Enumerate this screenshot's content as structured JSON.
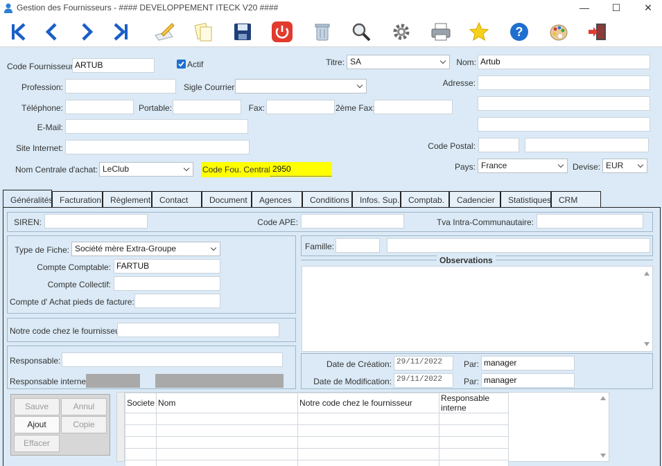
{
  "window": {
    "title": "Gestion des Fournisseurs - #### DEVELOPPEMENT ITECK V20 ####",
    "minimize": "—",
    "maximize": "☐",
    "close": "✕"
  },
  "toolbar": [
    "first-icon",
    "prev-icon",
    "next-icon",
    "last-icon",
    "edit-icon",
    "copy-icon",
    "save-icon",
    "power-icon",
    "trash-icon",
    "search-icon",
    "settings-icon",
    "print-icon",
    "star-icon",
    "help-icon",
    "palette-icon",
    "exit-icon"
  ],
  "header": {
    "code_label": "Code Fournisseur:",
    "code_value": "ARTUB",
    "actif_label": "Actif",
    "titre_label": "Titre:",
    "titre_value": "SA",
    "nom_label": "Nom:",
    "nom_value": "Artub",
    "profession_label": "Profession:",
    "sigle_label": "Sigle Courrier:",
    "adresse_label": "Adresse:",
    "telephone_label": "Téléphone:",
    "portable_label": "Portable:",
    "fax_label": "Fax:",
    "fax2_label": "2ème Fax:",
    "email_label": "E-Mail:",
    "site_label": "Site Internet:",
    "code_postal_label": "Code Postal:",
    "centrale_label": "Nom Centrale d'achat:",
    "centrale_value": "LeClub",
    "code_centrale_label": "Code Fou. Centrale:",
    "code_centrale_value": "2950",
    "pays_label": "Pays:",
    "pays_value": "France",
    "devise_label": "Devise:",
    "devise_value": "EUR"
  },
  "tabs": [
    "Généralités",
    "Facturation",
    "Règlement",
    "Contact",
    "Document",
    "Agences",
    "Conditions",
    "Infos. Sup.",
    "Comptab.",
    "Cadencier",
    "Statistiques",
    "CRM"
  ],
  "generalites": {
    "siren_label": "SIREN:",
    "ape_label": "Code APE:",
    "tva_label": "Tva Intra-Communautaire:",
    "type_fiche_label": "Type de Fiche:",
    "type_fiche_value": "Société mère Extra-Groupe",
    "compte_comptable_label": "Compte Comptable:",
    "compte_comptable_value": "FARTUB",
    "compte_collectif_label": "Compte Collectif:",
    "compte_achat_label": "Compte d' Achat pieds de facture:",
    "notre_code_label": "Notre code chez le fournisseur:",
    "responsable_label": "Responsable:",
    "responsable_interne_label": "Responsable interne:",
    "famille_label": "Famille:",
    "observations_label": "Observations",
    "date_creation_label": "Date de Création:",
    "date_creation_value": "29/11/2022",
    "date_modif_label": "Date de Modification:",
    "date_modif_value": "29/11/2022",
    "par_label": "Par:",
    "par_creation_value": "manager",
    "par_modif_value": "manager"
  },
  "buttons": {
    "sauve": "Sauve",
    "annul": "Annul",
    "ajout": "Ajout",
    "copie": "Copie",
    "effacer": "Effacer"
  },
  "grid": {
    "headers": [
      "Societe",
      "Nom",
      "Notre code chez le fournisseur",
      "Responsable interne"
    ],
    "rows": 5
  },
  "colors": {
    "background": "#dbeaf6",
    "highlight": "#ffff00",
    "accent": "#1a5fc8"
  }
}
